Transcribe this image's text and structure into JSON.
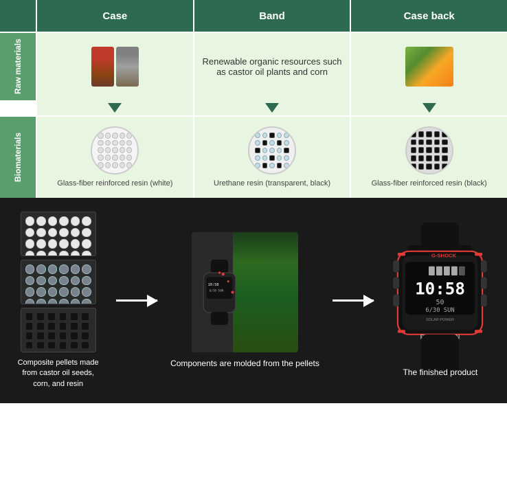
{
  "header": {
    "col_case": "Case",
    "col_band": "Band",
    "col_caseback": "Case back"
  },
  "row_labels": {
    "raw": "Raw materials",
    "bio": "Biomaterials"
  },
  "raw_band_text": "Renewable organic resources such as castor oil plants and corn",
  "bio_labels": {
    "case": "Glass-fiber reinforced resin (white)",
    "band": "Urethane resin (transparent, black)",
    "caseback": "Glass-fiber reinforced resin (black)"
  },
  "bottom": {
    "pellets_label": "Composite pellets made from\ncastor oil seeds, corn, and resin",
    "molded_label": "Components are\nmolded from the pellets",
    "finished_label": "The finished product"
  }
}
